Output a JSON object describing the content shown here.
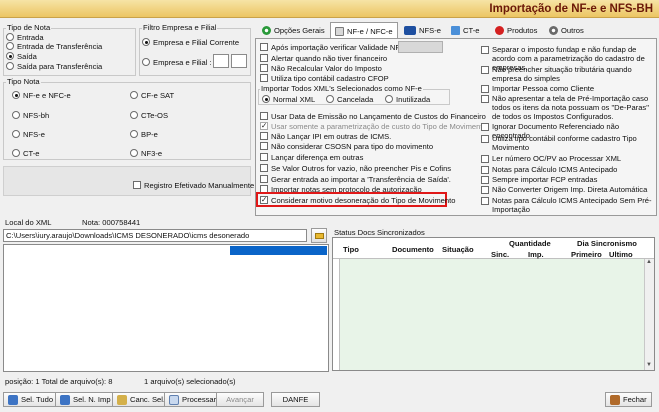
{
  "window": {
    "title": "Importação de NF-e e NFS-BH"
  },
  "tipo_nota": {
    "label": "Tipo de Nota",
    "options": [
      "Entrada",
      "Entrada de Transferência",
      "Saída",
      "Saída para Transferência"
    ],
    "selected": "Saída"
  },
  "filtro": {
    "label": "Filtro Empresa e Filial",
    "opt1": "Empresa e Filial Corrente",
    "opt2": "Empresa e Filial :",
    "selected": "Empresa e Filial Corrente"
  },
  "tipo_nota2": {
    "label": "Tipo Nota",
    "options": [
      "NF-e e NFC-e",
      "CF-e SAT",
      "NFS-bh",
      "CTe-OS",
      "NFS-e",
      "BP-e",
      "CT-e",
      "NF3-e"
    ],
    "selected": "NF-e e NFC-e"
  },
  "registro": {
    "label": "Registro Efetivado Manualmente",
    "checked": false
  },
  "tabs": [
    {
      "label": "Opções Gerais",
      "icon": "gear-icon",
      "active": false
    },
    {
      "label": "NF-e / NFC-e",
      "icon": "document-icon",
      "active": true
    },
    {
      "label": "NFS-e",
      "icon": "service-icon",
      "active": false
    },
    {
      "label": "CT-e",
      "icon": "truck-icon",
      "active": false
    },
    {
      "label": "Produtos",
      "icon": "product-icon",
      "active": false
    },
    {
      "label": "Outros",
      "icon": "cog-icon",
      "active": false
    }
  ],
  "left_options": {
    "o1": "Após importação verificar Validade NF-e",
    "o2": "Alertar quando não tiver financeiro",
    "o3": "Não Recalcular Valor do Imposto",
    "o4": "Utiliza tipo contábil cadastro CFOP",
    "import_label": "Importar Todos XML's Selecionados como NF-e",
    "import_opts": [
      "Normal XML",
      "Cancelada",
      "Inutilizada"
    ],
    "import_selected": "Normal XML",
    "o5": "Usar Data de Emissão no Lançamento de Custos do Financeiro",
    "o6": "Usar somente a parametrização de custo do Tipo de Movimento",
    "o7": "Não Lançar IPI em outras de ICMS.",
    "o8": "Não considerar CSOSN para tipo do movimento",
    "o9": "Lançar diferença em outras",
    "o10": "Se Valor Outros for vazio, não preencher Pis e Cofins",
    "o11": "Gerar entrada ao importar a 'Transferência de Saída'.",
    "o12": "Importar notas sem protocolo de autorização",
    "o13": "Considerar motivo desoneração do Tipo de Movimento"
  },
  "right_options": {
    "r1": "Separar o imposto fundap e não fundap de acordo com a parametrização do cadastro de empresas.",
    "r2": "Não preencher situação tributária quando empresa do simples",
    "r3": "Importar Pessoa como Cliente",
    "r4": "Não apresentar a tela de Pré-Importação caso todos os itens da nota possuam os \"De-Paras\" de todos os Impostos Configurados.",
    "r5": "Ignorar Documento Referenciado não encontrado",
    "r6": "Utiliza tipo contábil conforme cadastro Tipo Movimento",
    "r7": "Ler número OC/PV ao Processar XML",
    "r8": "Notas para Cálculo ICMS Antecipado",
    "r9": "Sempre importar FCP entradas",
    "r10": "Não Converter Origem Imp. Direta Automática",
    "r11": "Notas para Cálculo ICMS Antecipado Sem Pré-Importação"
  },
  "local": {
    "label": "Local do XML",
    "nota": "Nota: 000758441",
    "path": "C:\\Users\\iury.araujo\\Downloads\\ICMS DESONERADO\\icms desonerado"
  },
  "status": {
    "label": "Status Docs Sincronizados",
    "headers": {
      "tipo": "Tipo",
      "documento": "Documento",
      "situacao": "Situação",
      "quantidade": "Quantidade",
      "sinc": "Sinc.",
      "imp": "Imp.",
      "dia_sinc": "Dia Sincronismo",
      "primeiro": "Primeiro",
      "ultimo": "Ultimo"
    }
  },
  "footer": {
    "posicao": "posição: 1  Total de arquivo(s): 8",
    "selecionados": "1 arquivo(s) selecionado(s)"
  },
  "buttons": {
    "sel_tudo": "Sel. Tudo",
    "sel_n_imp": "Sel. N. Imp",
    "canc_sel": "Canc. Sel.",
    "processar": "Processar",
    "avancar": "Avançar",
    "danfe": "DANFE",
    "fechar": "Fechar"
  },
  "colors": {
    "highlight": "#e01818",
    "selection": "#0a64c8",
    "title": "#6b1808"
  }
}
